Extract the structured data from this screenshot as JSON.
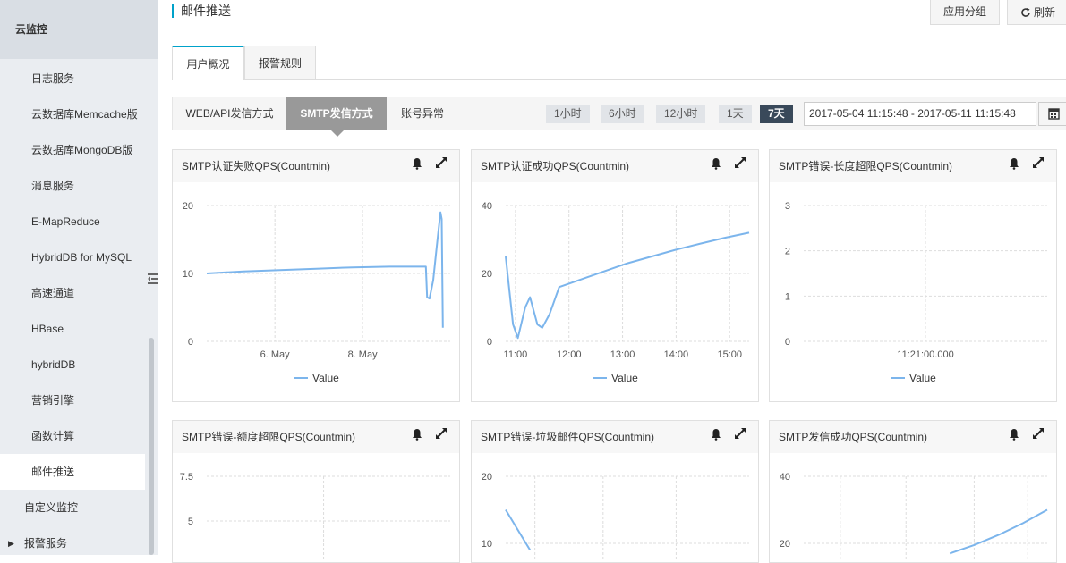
{
  "sidebar": {
    "title": "云监控",
    "items": [
      {
        "label": "日志服务"
      },
      {
        "label": "云数据库Memcache版"
      },
      {
        "label": "云数据库MongoDB版"
      },
      {
        "label": "消息服务"
      },
      {
        "label": "E-MapReduce"
      },
      {
        "label": "HybridDB for MySQL"
      },
      {
        "label": "高速通道"
      },
      {
        "label": "HBase"
      },
      {
        "label": "hybridDB"
      },
      {
        "label": "营销引擎"
      },
      {
        "label": "函数计算"
      },
      {
        "label": "邮件推送",
        "active": true
      }
    ],
    "custom_monitor": "自定义监控",
    "alert_service": "报警服务"
  },
  "header": {
    "title": "邮件推送",
    "app_group_button": "应用分组",
    "refresh_button": "刷新"
  },
  "tabs": [
    {
      "label": "用户概况",
      "active": true
    },
    {
      "label": "报警规则",
      "active": false
    }
  ],
  "subtabs": [
    {
      "label": "WEB/API发信方式",
      "active": false
    },
    {
      "label": "SMTP发信方式",
      "active": true
    },
    {
      "label": "账号异常",
      "active": false
    }
  ],
  "time_buttons": [
    {
      "label": "1小时",
      "active": false
    },
    {
      "label": "6小时",
      "active": false
    },
    {
      "label": "12小时",
      "active": false
    },
    {
      "label": "1天",
      "active": false
    },
    {
      "label": "7天",
      "active": true
    }
  ],
  "date_range": "2017-05-04 11:15:48 - 2017-05-11 11:15:48",
  "colors": {
    "accent": "#00a2ca",
    "line": "#7cb5ec",
    "active_time": "#39495a"
  },
  "chart_data": [
    {
      "type": "line",
      "title": "SMTP认证失败QPS(Countmin)",
      "ylim": [
        0,
        20
      ],
      "yticks": [
        0,
        10,
        20
      ],
      "xticks": [
        "6. May",
        "8. May"
      ],
      "series": [
        {
          "name": "Value",
          "values": [
            [
              0,
              10
            ],
            [
              0.15,
              10.3
            ],
            [
              0.3,
              10.5
            ],
            [
              0.45,
              10.7
            ],
            [
              0.6,
              10.9
            ],
            [
              0.75,
              11
            ],
            [
              0.87,
              11
            ],
            [
              0.9,
              11
            ],
            [
              0.905,
              6.5
            ],
            [
              0.915,
              6.3
            ],
            [
              0.93,
              9
            ],
            [
              0.945,
              14
            ],
            [
              0.96,
              19
            ],
            [
              0.965,
              18
            ],
            [
              0.97,
              2
            ]
          ]
        }
      ]
    },
    {
      "type": "line",
      "title": "SMTP认证成功QPS(Countmin)",
      "ylim": [
        0,
        40
      ],
      "yticks": [
        0,
        20,
        40
      ],
      "xticks": [
        "11:00",
        "12:00",
        "13:00",
        "14:00",
        "15:00"
      ],
      "series": [
        {
          "name": "Value",
          "values": [
            [
              0,
              25
            ],
            [
              0.03,
              5
            ],
            [
              0.05,
              1
            ],
            [
              0.08,
              10
            ],
            [
              0.1,
              13
            ],
            [
              0.13,
              5
            ],
            [
              0.15,
              4
            ],
            [
              0.18,
              8
            ],
            [
              0.2,
              12
            ],
            [
              0.22,
              16
            ],
            [
              0.3,
              18
            ],
            [
              0.4,
              20.5
            ],
            [
              0.5,
              23
            ],
            [
              0.6,
              25
            ],
            [
              0.7,
              27
            ],
            [
              0.8,
              28.8
            ],
            [
              0.9,
              30.5
            ],
            [
              1.0,
              32
            ]
          ]
        }
      ]
    },
    {
      "type": "line",
      "title": "SMTP错误-长度超限QPS(Countmin)",
      "ylim": [
        0,
        3
      ],
      "yticks": [
        0,
        1,
        2,
        3
      ],
      "xticks": [
        "11:21:00.000"
      ],
      "series": [
        {
          "name": "Value",
          "values": []
        }
      ]
    },
    {
      "type": "line",
      "title": "SMTP错误-额度超限QPS(Countmin)",
      "yticks": [
        5,
        7.5
      ],
      "series": [
        {
          "values": []
        }
      ]
    },
    {
      "type": "line",
      "title": "SMTP错误-垃圾邮件QPS(Countmin)",
      "yticks": [
        10,
        20
      ],
      "series": [
        {
          "values": [
            [
              0,
              15
            ],
            [
              0.1,
              9
            ]
          ]
        }
      ]
    },
    {
      "type": "line",
      "title": "SMTP发信成功QPS(Countmin)",
      "yticks": [
        20,
        40
      ],
      "series": [
        {
          "values": [
            [
              0.6,
              17
            ],
            [
              0.7,
              19.5
            ],
            [
              0.8,
              22.5
            ],
            [
              0.9,
              26
            ],
            [
              1.0,
              30
            ]
          ]
        }
      ]
    }
  ],
  "legend_label": "Value"
}
